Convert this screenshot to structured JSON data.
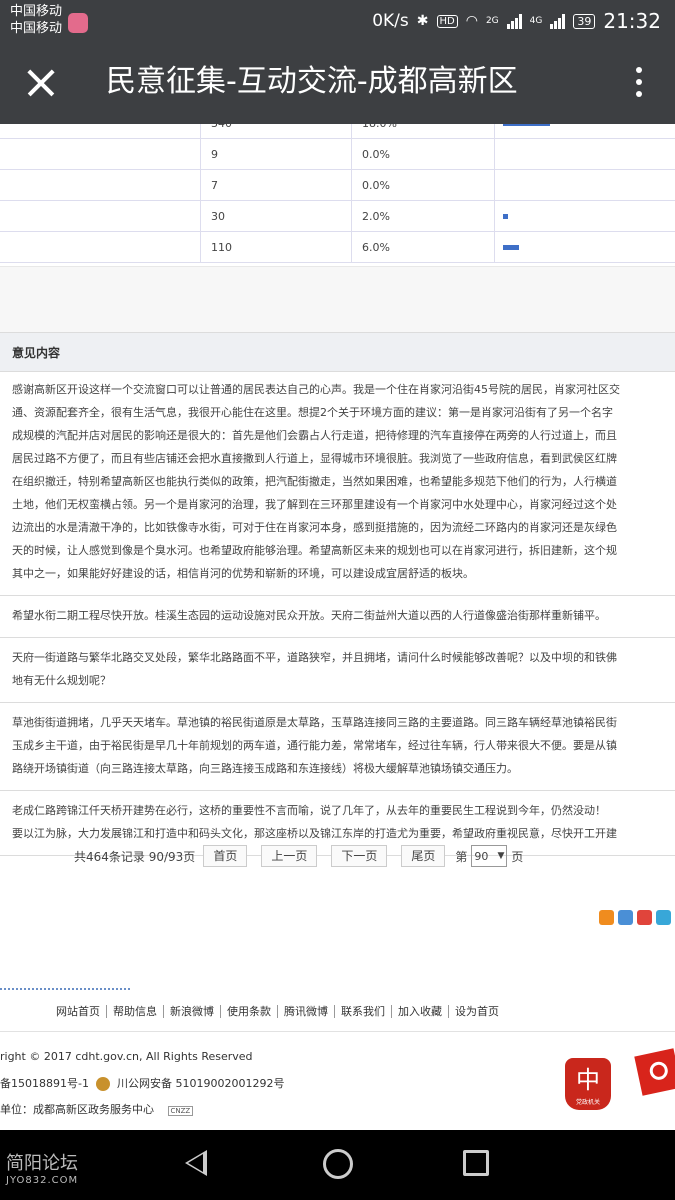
{
  "status_bar": {
    "carrier1": "中国移动",
    "carrier2": "中国移动",
    "speed": "0K/s",
    "bluetooth_icon": "bluetooth-icon",
    "hd": "HD",
    "wifi_icon": "wifi-icon",
    "net1": "2G",
    "net2": "4G",
    "battery": "39",
    "time": "21:32"
  },
  "title_bar": {
    "title": "民意征集-互动交流-成都高新区",
    "close_icon": "close-icon",
    "more_icon": "more-vertical-icon"
  },
  "stats_table": {
    "rows": [
      {
        "count": "340",
        "percent": "18.0%",
        "bar_percent": 18
      },
      {
        "count": "9",
        "percent": "0.0%",
        "bar_percent": 0
      },
      {
        "count": "7",
        "percent": "0.0%",
        "bar_percent": 0
      },
      {
        "count": "30",
        "percent": "2.0%",
        "bar_percent": 2
      },
      {
        "count": "110",
        "percent": "6.0%",
        "bar_percent": 6
      }
    ]
  },
  "opinions": {
    "header": "意见内容",
    "items": [
      {
        "lines": [
          "感谢高新区开设这样一个交流窗口可以让普通的居民表达自己的心声。我是一个住在肖家河沿街45号院的居民，肖家河社区交",
          "通、资源配套齐全，很有生活气息，我很开心能住在这里。想提2个关于环境方面的建议：第一是肖家河沿街有了另一个名字",
          "成规模的汽配并店对居民的影响还是很大的：首先是他们会霸占人行走道，把待修理的汽车直接停在两旁的人行过道上，而且",
          "居民过路不方便了，而且有些店铺还会把水直接撒到人行道上，显得城市环境很脏。我浏览了一些政府信息，看到武侯区红牌",
          "在组织撤迁，特别希望高新区也能执行类似的政策，把汽配街撤走，当然如果困难，也希望能多规范下他们的行为，人行横道",
          "土地，他们无权蛮横占领。另一个是肖家河的治理，我了解到在三环那里建设有一个肖家河中水处理中心，肖家河经过这个处",
          "边流出的水是清澈干净的，比如铁像寺水街，可对于住在肖家河本身，感到挺措施的，因为流经二环路内的肖家河还是灰绿色",
          "天的时候，让人感觉到像是个臭水河。也希望政府能够治理。希望高新区未来的规划也可以在肖家河进行，拆旧建新，这个规",
          "其中之一，如果能好好建设的话，相信肖河的优势和崭新的环境，可以建设成宜居舒适的板块。"
        ]
      },
      {
        "lines": [
          "希望水衔二期工程尽快开放。桂溪生态园的运动设施对民众开放。天府二街益州大道以西的人行道像盛治街那样重新铺平。"
        ]
      },
      {
        "lines": [
          "天府一街道路与繁华北路交叉处段，繁华北路路面不平，道路狭窄，并且拥堵，请问什么时候能够改善呢？以及中坝的和铁佛",
          "地有无什么规划呢？"
        ]
      },
      {
        "lines": [
          "草池街街道拥堵，几乎天天堵车。草池镇的裕民街道原是太草路，玉草路连接同三路的主要道路。同三路车辆经草池镇裕民街",
          "玉成乡主干道，由于裕民街是早几十年前规划的两车道，通行能力差，常常堵车，经过往车辆，行人带来很大不便。要是从镇",
          "路绕开场镇街道（向三路连接太草路，向三路连接玉成路和东连接线）将极大缓解草池镇场镇交通压力。"
        ]
      },
      {
        "lines": [
          "老成仁路跨锦江仟天桥开建势在必行，这桥的重要性不言而喻，说了几年了，从去年的重要民生工程说到今年，仍然没动！",
          "要以江为脉，大力发展锦江和打造中和码头文化，那这座桥以及锦江东岸的打造尤为重要，希望政府重视民意，尽快开工开建"
        ]
      }
    ]
  },
  "pagination": {
    "summary": "共464条记录 90/93页",
    "first": "首页",
    "prev": "上一页",
    "next": "下一页",
    "last": "尾页",
    "goto_prefix": "第",
    "selected_page": "90",
    "goto_suffix": "页"
  },
  "share_icons": [
    {
      "name": "share-plus-icon",
      "color": "#f08c1e"
    },
    {
      "name": "share-qzone-icon",
      "color": "#4a8fd6"
    },
    {
      "name": "share-weibo-icon",
      "color": "#e0443b"
    },
    {
      "name": "share-tencent-icon",
      "color": "#38a7d8"
    }
  ],
  "footer": {
    "nav": [
      "网站首页",
      "帮助信息",
      "新浪微博",
      "使用条款",
      "腾讯微博",
      "联系我们",
      "加入收藏",
      "设为首页"
    ],
    "copyright": "right © 2017 cdht.gov.cn, All Rights Reserved",
    "icp_prefix": "备15018891号-1",
    "police": "川公网安备 51019002001292号",
    "office": "单位：成都高新区政务服务中心",
    "cnzz": "CNZZ",
    "gov_badge_label": "党政机关"
  },
  "watermark": {
    "line1": "简阳论坛",
    "line2": "JYO832.COM"
  }
}
